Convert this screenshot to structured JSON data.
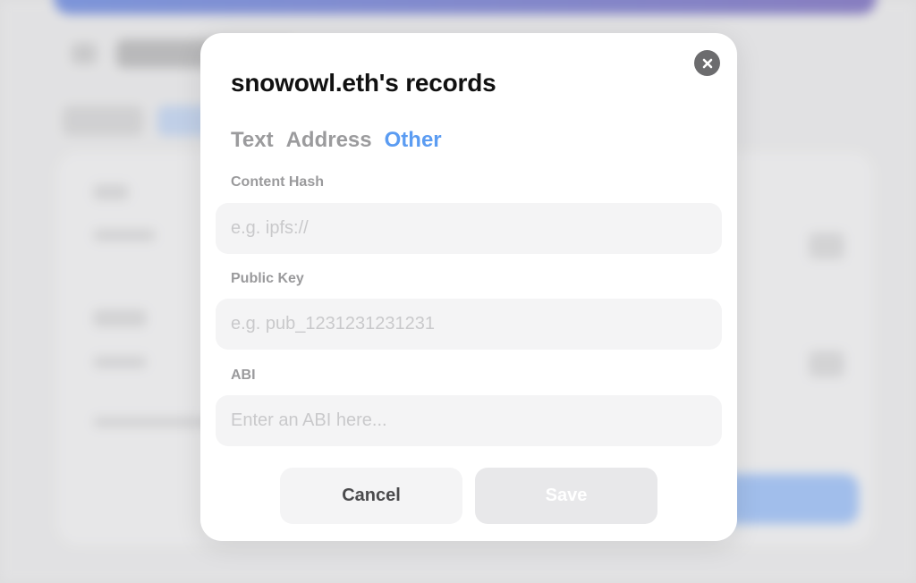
{
  "modal": {
    "title": "snowowl.eth's records",
    "tabs": [
      {
        "label": "Text",
        "active": false
      },
      {
        "label": "Address",
        "active": false
      },
      {
        "label": "Other",
        "active": true
      }
    ],
    "fields": [
      {
        "label": "Content Hash",
        "value": "",
        "placeholder": "e.g. ipfs://"
      },
      {
        "label": "Public Key",
        "value": "",
        "placeholder": "e.g. pub_1231231231231"
      },
      {
        "label": "ABI",
        "value": "",
        "placeholder": "Enter an ABI here..."
      }
    ],
    "cancel_label": "Cancel",
    "save_label": "Save",
    "close_icon": "close-icon"
  },
  "colors": {
    "accent": "#5b9cf2",
    "modal_bg": "#ffffff",
    "input_bg": "#f4f4f5",
    "save_disabled_bg": "#e8e8ea"
  }
}
